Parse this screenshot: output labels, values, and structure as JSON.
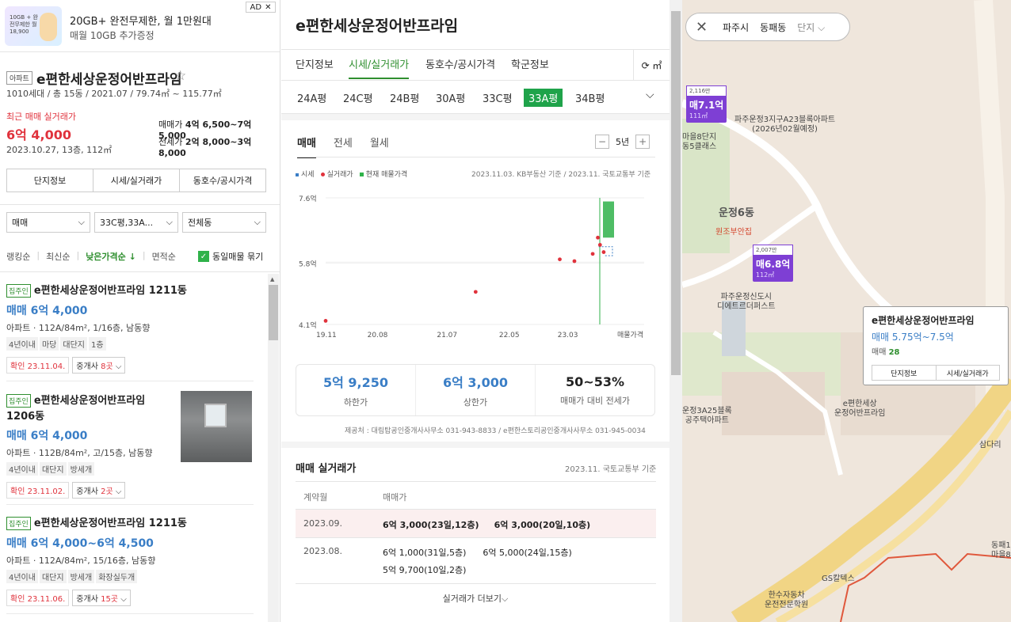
{
  "ad": {
    "thumb_text": "10GB + 완전무제한 월18,900",
    "title": "20GB+ 완전무제한, 월 1만원대",
    "subtitle": "매월 10GB 추가증정",
    "tag": "AD",
    "close": "✕"
  },
  "complex": {
    "type_tag": "아파트",
    "name": "e편한세상운정어반프라임",
    "star": "☆",
    "meta": "1010세대 / 총 15동 / 2021.07 / 79.74㎡ ~ 115.77㎡",
    "recent_label": "최근 매매 실거래가",
    "recent_price": "6억 4,000",
    "recent_date": "2023.10.27, 13층, 112㎡",
    "sale_label": "매매가",
    "sale_range": "4억 6,500~7억 5,000",
    "jeonse_label": "전세가",
    "jeonse_range": "2억 8,000~3억 8,000",
    "tabs": [
      "단지정보",
      "시세/실거래가",
      "동호수/공시가격"
    ]
  },
  "filters": {
    "trade": "매매",
    "size": "33C평,33A...",
    "dong": "전체동"
  },
  "sort": {
    "items": [
      "랭킹순",
      "최신순",
      "낮은가격순 ↓",
      "면적순"
    ],
    "same_label": "동일매물 묶기",
    "check": "✓"
  },
  "listings": [
    {
      "badge": "집주인",
      "title": "e편한세상운정어반프라임 1211동",
      "price": "매매 6억 4,000",
      "desc": "아파트 · 112A/84m², 1/16층, 남동향",
      "chips": [
        "4년이내",
        "마당",
        "대단지",
        "1층"
      ],
      "confirm": "확인 23.11.04.",
      "agents_pre": "중개사 ",
      "agents_cnt": "8곳",
      "agents_arrow": " ⌵"
    },
    {
      "badge": "집주인",
      "title": "e편한세상운정어반프라임 1206동",
      "price": "매매 6억 4,000",
      "desc": "아파트 · 112B/84m², 고/15층, 남동향",
      "chips": [
        "4년이내",
        "대단지",
        "방세개"
      ],
      "confirm": "확인 23.11.02.",
      "agents_pre": "중개사 ",
      "agents_cnt": "2곳",
      "agents_arrow": " ⌵"
    },
    {
      "badge": "집주인",
      "title": "e편한세상운정어반프라임 1211동",
      "price": "매매 6억 4,000~6억 4,500",
      "desc": "아파트 · 112A/84m², 15/16층, 남동향",
      "chips": [
        "4년이내",
        "대단지",
        "방세개",
        "화장실두개"
      ],
      "confirm": "확인 23.11.06.",
      "agents_pre": "중개사 ",
      "agents_cnt": "15곳",
      "agents_arrow": " ⌵"
    }
  ],
  "detail": {
    "title": "e편한세상운정어반프라임",
    "tabs": [
      "단지정보",
      "시세/실거래가",
      "동호수/공시가격",
      "학군정보"
    ],
    "refresh": "⟳ ㎡",
    "pyeong": [
      "24A평",
      "24C평",
      "24B평",
      "30A평",
      "33C평",
      "33A평",
      "34B평"
    ],
    "pyeong_selected": "33A평",
    "dropdown": "⌵",
    "chart_tabs": [
      "매매",
      "전세",
      "월세"
    ],
    "period": "5년",
    "minus": "−",
    "plus": "+",
    "legend": [
      "시세",
      "실거래가",
      "현재 매물가격"
    ],
    "source": "2023.11.03. KB부동산 기준 / 2023.11. 국토교통부 기준",
    "stats": [
      {
        "value": "5억 9,250",
        "label": "하한가"
      },
      {
        "value": "6억 3,000",
        "label": "상한가"
      },
      {
        "value": "50~53%",
        "label": "매매가 대비 전세가"
      }
    ],
    "provider": "제공처 : 대림탑공인중개사사무소 031-943-8833 / e편한스토리공인중개사사무소 031-945-0034",
    "real_title": "매매 실거래가",
    "real_source": "2023.11. 국토교통부 기준",
    "table_head": [
      "계약월",
      "매매가"
    ],
    "rows": [
      {
        "month": "2023.09.",
        "line1": "6억 3,000(23일,12층)     6억 3,000(20일,10층)",
        "line2": ""
      },
      {
        "month": "2023.08.",
        "line1": "6억 1,000(31일,5층)      6억 5,000(24일,15층)",
        "line2": "5억 9,700(10일,2층)"
      }
    ],
    "more": "실거래가 더보기⌵"
  },
  "chart_data": {
    "type": "scatter",
    "y_tick_labels": [
      "7.6억",
      "5.8억",
      "4.1억"
    ],
    "x_tick_labels": [
      "19.11",
      "20.08",
      "21.07",
      "22.05",
      "23.03",
      "매물가격"
    ],
    "ylim": [
      4.1,
      7.6
    ],
    "series": [
      {
        "name": "실거래가",
        "color": "#e0323c",
        "points": [
          [
            2019.9,
            4.2
          ],
          [
            2021.95,
            5.0
          ],
          [
            2023.1,
            5.9
          ],
          [
            2023.3,
            5.85
          ],
          [
            2023.55,
            6.05
          ],
          [
            2023.62,
            6.5
          ],
          [
            2023.65,
            6.3
          ],
          [
            2023.7,
            6.1
          ]
        ]
      },
      {
        "name": "현재 매물가격",
        "color": "#2fb24a",
        "range": [
          6.5,
          7.5
        ]
      }
    ]
  },
  "map": {
    "close": "✕",
    "breadcrumb": [
      "파주시",
      "동패동",
      "단지"
    ],
    "pins": [
      {
        "top": "2,116만",
        "price": "매7.1억",
        "area": "111㎡"
      },
      {
        "top": "2,007만",
        "price": "매6.8억",
        "area": "112㎡"
      }
    ],
    "labels": {
      "a": "파주운정3지구A23블록아파트\n(2026년02월예정)",
      "b": "마을8단지\n동5클래스",
      "c": "운정6동",
      "d": "원조부안집",
      "e": "파주운정신도시\n디에트르더퍼스트",
      "f": "e편한세상\n운정어반프라임",
      "g": "운정3A25블록\n공주택아파트",
      "h": "한수자동차\n운전전문학원",
      "i": "GS칼텍스",
      "j": "삼다리",
      "k": "동패1\n마을8"
    },
    "popup": {
      "title": "e편한세상운정어반프라임",
      "price": "매매 5.75억~7.5억",
      "count_label": "매매 ",
      "count": "28",
      "btns": [
        "단지정보",
        "시세/실거래가"
      ]
    }
  }
}
